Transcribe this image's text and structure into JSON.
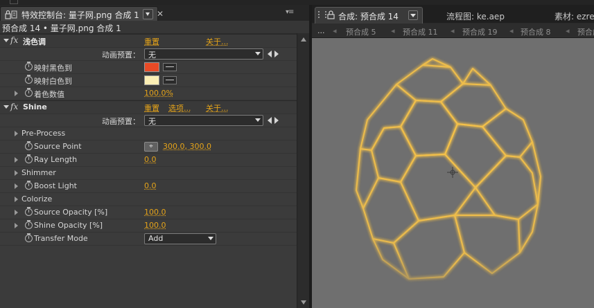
{
  "left_panel": {
    "tab_title": "特效控制台: 量子网.png 合成 1",
    "subtitle": "预合成 14 • 量子网.png 合成 1",
    "effects": [
      {
        "name": "浅色调",
        "links": [
          "重置",
          "关于..."
        ],
        "preset_label": "动画预置：",
        "preset_value": "无",
        "properties": [
          {
            "label": "映射黑色到",
            "color": "#e84a26"
          },
          {
            "label": "映射白色到",
            "color": "#fbeeb4"
          },
          {
            "label": "着色数值",
            "value": "100.0%"
          }
        ]
      },
      {
        "name": "Shine",
        "links": [
          "重置",
          "选项...",
          "关于..."
        ],
        "preset_label": "动画预置：",
        "preset_value": "无",
        "properties": [
          {
            "label": "Pre-Process"
          },
          {
            "label": "Source Point",
            "value": "300.0, 300.0"
          },
          {
            "label": "Ray Length",
            "value": "0.0"
          },
          {
            "label": "Shimmer"
          },
          {
            "label": "Boost Light",
            "value": "0.0"
          },
          {
            "label": "Colorize"
          },
          {
            "label": "Source Opacity [%]",
            "value": "100.0"
          },
          {
            "label": "Shine Opacity [%]",
            "value": "100.0"
          },
          {
            "label": "Transfer Mode",
            "value": "Add"
          }
        ]
      }
    ]
  },
  "right_panel": {
    "tabs": [
      "合成: 预合成 14",
      "流程图: ke.aep",
      "素材: ezrea"
    ],
    "breadcrumb": [
      "...",
      "预合成 5",
      "预合成 11",
      "预合成 19",
      "预合成 8",
      "预合成"
    ]
  },
  "colors": {
    "accent_link": "#e6a419",
    "viewer_bg": "#6f6f6f",
    "glow": "#f6c24a"
  }
}
